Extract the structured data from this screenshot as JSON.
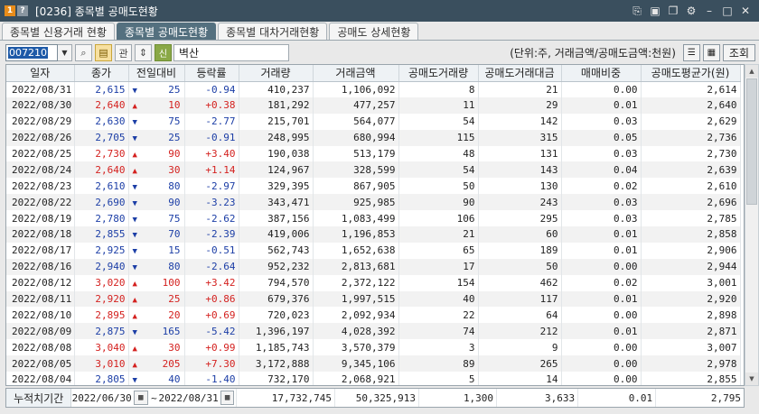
{
  "window": {
    "badge1": "1",
    "badge2": "?",
    "title": "[0236] 종목별 공매도현황",
    "icons": [
      "link-icon",
      "save-icon",
      "window-icon",
      "gear-icon",
      "minimize-icon",
      "maximize-icon",
      "close-icon"
    ]
  },
  "tabs": [
    {
      "label": "종목별 신용거래 현황",
      "active": false
    },
    {
      "label": "종목별 공매도현황",
      "active": true
    },
    {
      "label": "종목별 대차거래현황",
      "active": false
    },
    {
      "label": "공매도 상세현황",
      "active": false
    }
  ],
  "toolbar": {
    "code": "007210",
    "gwan": "관",
    "shin": "신",
    "stock_name": "벽산",
    "unit_note": "(단위:주, 거래금액/공매도금액:천원)",
    "lookup": "조회"
  },
  "columns": [
    "일자",
    "종가",
    "전일대비",
    "등락률",
    "거래량",
    "거래금액",
    "공매도거래량",
    "공매도거래대금",
    "매매비중",
    "공매도평균가(원)"
  ],
  "rows": [
    {
      "date": "2022/08/31",
      "close": "2,615",
      "dir": "down",
      "chg": "25",
      "rate": "-0.94",
      "vol": "410,237",
      "amt": "1,106,092",
      "svol": "8",
      "samt": "21",
      "ratio": "0.00",
      "savg": "2,614"
    },
    {
      "date": "2022/08/30",
      "close": "2,640",
      "dir": "up",
      "chg": "10",
      "rate": "+0.38",
      "vol": "181,292",
      "amt": "477,257",
      "svol": "11",
      "samt": "29",
      "ratio": "0.01",
      "savg": "2,640"
    },
    {
      "date": "2022/08/29",
      "close": "2,630",
      "dir": "down",
      "chg": "75",
      "rate": "-2.77",
      "vol": "215,701",
      "amt": "564,077",
      "svol": "54",
      "samt": "142",
      "ratio": "0.03",
      "savg": "2,629"
    },
    {
      "date": "2022/08/26",
      "close": "2,705",
      "dir": "down",
      "chg": "25",
      "rate": "-0.91",
      "vol": "248,995",
      "amt": "680,994",
      "svol": "115",
      "samt": "315",
      "ratio": "0.05",
      "savg": "2,736"
    },
    {
      "date": "2022/08/25",
      "close": "2,730",
      "dir": "up",
      "chg": "90",
      "rate": "+3.40",
      "vol": "190,038",
      "amt": "513,179",
      "svol": "48",
      "samt": "131",
      "ratio": "0.03",
      "savg": "2,730"
    },
    {
      "date": "2022/08/24",
      "close": "2,640",
      "dir": "up",
      "chg": "30",
      "rate": "+1.14",
      "vol": "124,967",
      "amt": "328,599",
      "svol": "54",
      "samt": "143",
      "ratio": "0.04",
      "savg": "2,639"
    },
    {
      "date": "2022/08/23",
      "close": "2,610",
      "dir": "down",
      "chg": "80",
      "rate": "-2.97",
      "vol": "329,395",
      "amt": "867,905",
      "svol": "50",
      "samt": "130",
      "ratio": "0.02",
      "savg": "2,610"
    },
    {
      "date": "2022/08/22",
      "close": "2,690",
      "dir": "down",
      "chg": "90",
      "rate": "-3.23",
      "vol": "343,471",
      "amt": "925,985",
      "svol": "90",
      "samt": "243",
      "ratio": "0.03",
      "savg": "2,696"
    },
    {
      "date": "2022/08/19",
      "close": "2,780",
      "dir": "down",
      "chg": "75",
      "rate": "-2.62",
      "vol": "387,156",
      "amt": "1,083,499",
      "svol": "106",
      "samt": "295",
      "ratio": "0.03",
      "savg": "2,785"
    },
    {
      "date": "2022/08/18",
      "close": "2,855",
      "dir": "down",
      "chg": "70",
      "rate": "-2.39",
      "vol": "419,006",
      "amt": "1,196,853",
      "svol": "21",
      "samt": "60",
      "ratio": "0.01",
      "savg": "2,858"
    },
    {
      "date": "2022/08/17",
      "close": "2,925",
      "dir": "down",
      "chg": "15",
      "rate": "-0.51",
      "vol": "562,743",
      "amt": "1,652,638",
      "svol": "65",
      "samt": "189",
      "ratio": "0.01",
      "savg": "2,906"
    },
    {
      "date": "2022/08/16",
      "close": "2,940",
      "dir": "down",
      "chg": "80",
      "rate": "-2.64",
      "vol": "952,232",
      "amt": "2,813,681",
      "svol": "17",
      "samt": "50",
      "ratio": "0.00",
      "savg": "2,944"
    },
    {
      "date": "2022/08/12",
      "close": "3,020",
      "dir": "up",
      "chg": "100",
      "rate": "+3.42",
      "vol": "794,570",
      "amt": "2,372,122",
      "svol": "154",
      "samt": "462",
      "ratio": "0.02",
      "savg": "3,001"
    },
    {
      "date": "2022/08/11",
      "close": "2,920",
      "dir": "up",
      "chg": "25",
      "rate": "+0.86",
      "vol": "679,376",
      "amt": "1,997,515",
      "svol": "40",
      "samt": "117",
      "ratio": "0.01",
      "savg": "2,920"
    },
    {
      "date": "2022/08/10",
      "close": "2,895",
      "dir": "up",
      "chg": "20",
      "rate": "+0.69",
      "vol": "720,023",
      "amt": "2,092,934",
      "svol": "22",
      "samt": "64",
      "ratio": "0.00",
      "savg": "2,898"
    },
    {
      "date": "2022/08/09",
      "close": "2,875",
      "dir": "down",
      "chg": "165",
      "rate": "-5.42",
      "vol": "1,396,197",
      "amt": "4,028,392",
      "svol": "74",
      "samt": "212",
      "ratio": "0.01",
      "savg": "2,871"
    },
    {
      "date": "2022/08/08",
      "close": "3,040",
      "dir": "up",
      "chg": "30",
      "rate": "+0.99",
      "vol": "1,185,743",
      "amt": "3,570,379",
      "svol": "3",
      "samt": "9",
      "ratio": "0.00",
      "savg": "3,007"
    },
    {
      "date": "2022/08/05",
      "close": "3,010",
      "dir": "up",
      "chg": "205",
      "rate": "+7.30",
      "vol": "3,172,888",
      "amt": "9,345,106",
      "svol": "89",
      "samt": "265",
      "ratio": "0.00",
      "savg": "2,978"
    },
    {
      "date": "2022/08/04",
      "close": "2,805",
      "dir": "down",
      "chg": "40",
      "rate": "-1.40",
      "vol": "732,170",
      "amt": "2,068,921",
      "svol": "5",
      "samt": "14",
      "ratio": "0.00",
      "savg": "2,855"
    }
  ],
  "footer": {
    "label": "누적치기간",
    "from": "2022/06/30",
    "tilde": "~",
    "to": "2022/08/31",
    "vol": "17,732,745",
    "amt": "50,325,913",
    "svol": "1,300",
    "samt": "3,633",
    "ratio": "0.01",
    "savg": "2,795"
  }
}
